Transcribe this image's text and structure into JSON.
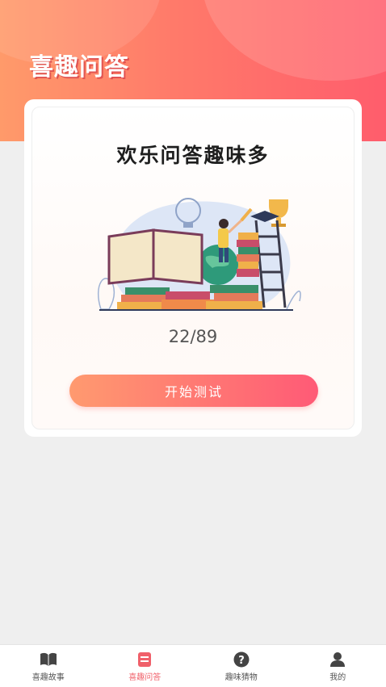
{
  "header": {
    "title": "喜趣问答",
    "accent_color": "#ff6a6a"
  },
  "quiz_card": {
    "heading": "欢乐问答趣味多",
    "progress": "22/89",
    "start_button": "开始测试",
    "illustration": "books-reading-illustration"
  },
  "tabbar": {
    "active_index": 1,
    "items": [
      {
        "label": "喜趣故事",
        "icon": "book-icon"
      },
      {
        "label": "喜趣问答",
        "icon": "quiz-card-icon"
      },
      {
        "label": "趣味猜物",
        "icon": "question-icon"
      },
      {
        "label": "我的",
        "icon": "person-icon"
      }
    ]
  }
}
